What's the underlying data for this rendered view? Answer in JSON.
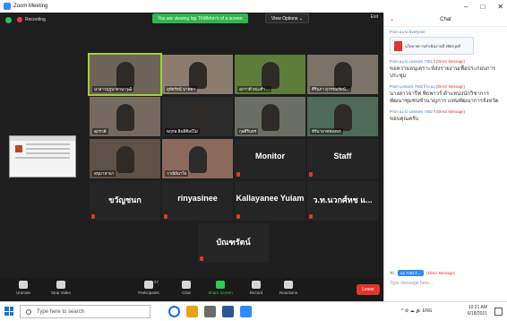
{
  "window": {
    "title": "Zoom Meeting",
    "minimize": "–",
    "maximize": "□",
    "close": "✕"
  },
  "meeting": {
    "recording_label": "Recording",
    "share_banner": "You are viewing Iqq ThWkhm'n of a screen",
    "view_options": "View Options ⌄",
    "exit_label": "Exit",
    "tiles": [
      {
        "name": "นาลาวฤภูนาดานาวุฒิ",
        "style": "video",
        "color": "#6d6358"
      },
      {
        "name": "อุทัยรัตน์ นาคคา",
        "style": "video",
        "color": "#8a7d6e"
      },
      {
        "name": "สุภาวดี ธนะคำ ...",
        "style": "video",
        "color": "#5f7d3a"
      },
      {
        "name": "ศิรินภา สุวรรณรัตน์...",
        "style": "video",
        "color": "#7c7368"
      },
      {
        "name": "สุภรวดี",
        "style": "video",
        "color": "#766a60"
      },
      {
        "name": "พฤกษ ลิมดิศิลป์ไผ่",
        "style": "dark",
        "color": "#2a2a2a"
      },
      {
        "name": "กุลศิรินทร",
        "style": "video",
        "color": "#6b6e63"
      },
      {
        "name": "พีร์นาลาคทองพร",
        "style": "video",
        "color": "#4d6b58"
      },
      {
        "name": "สุขุมาลานา",
        "style": "video",
        "color": "#5e5148"
      },
      {
        "name": "วาณีย์นาใจ",
        "style": "video",
        "color": "#8c6a5b"
      },
      {
        "name": "Monitor",
        "style": "label"
      },
      {
        "name": "Staff",
        "style": "label"
      },
      {
        "name": "ขวัญชนก",
        "style": "label"
      },
      {
        "name": "rinyasinee",
        "style": "label"
      },
      {
        "name": "Kallayanee Yuiam",
        "style": "label"
      },
      {
        "name": "ว.ท.นวกศ์หช แ...",
        "style": "label"
      },
      {
        "name": "บัณฑรัตน์",
        "style": "label"
      }
    ]
  },
  "toolbar": {
    "unmute": "Unmute",
    "stop_video": "Stop Video",
    "participants": "Participants",
    "participants_count": "27",
    "chat": "Chat",
    "share_screen": "Share Screen",
    "record": "Record",
    "reactions": "Reactions",
    "leave": "Leave"
  },
  "chat": {
    "title": "Chat",
    "messages": [
      {
        "from": "From ผอ to Everyone",
        "private": "",
        "text": "",
        "file": "นโยบายการดำเนินงานปี 2564.pdf"
      },
      {
        "from": "From ผอ to Lessons 7462 ll",
        "private": "(Direct Message)",
        "text": "ขอความอนุเคราะห์ส่งรายงานเพื่อประกอบการประชุม",
        "file": ""
      },
      {
        "from": "From Lessons 7462 ll to ผอ",
        "private": "(Direct Message)",
        "text": "นางสาวจารีฟ พิธพาวร์ ตำแหน่งนักวิชาการพัฒนาชุมชนชำนาญการ แทนพัฒนาการจังหวัด",
        "file": ""
      },
      {
        "from": "From ผอ to Lessons 7462 ll",
        "private": "(Direct Message)",
        "text": "ขอบคุณครับ",
        "file": ""
      }
    ],
    "to_label": "To:",
    "to_recipient": "ผอ 7462 ll ⌄",
    "to_private": "(Direct Message)",
    "input_placeholder": "Type message here..."
  },
  "taskbar": {
    "search_placeholder": "Type here to search",
    "time": "10:21 AM",
    "date": "6/18/2021",
    "tray": "^ ⚙ ☁ 🔊 ENG"
  }
}
